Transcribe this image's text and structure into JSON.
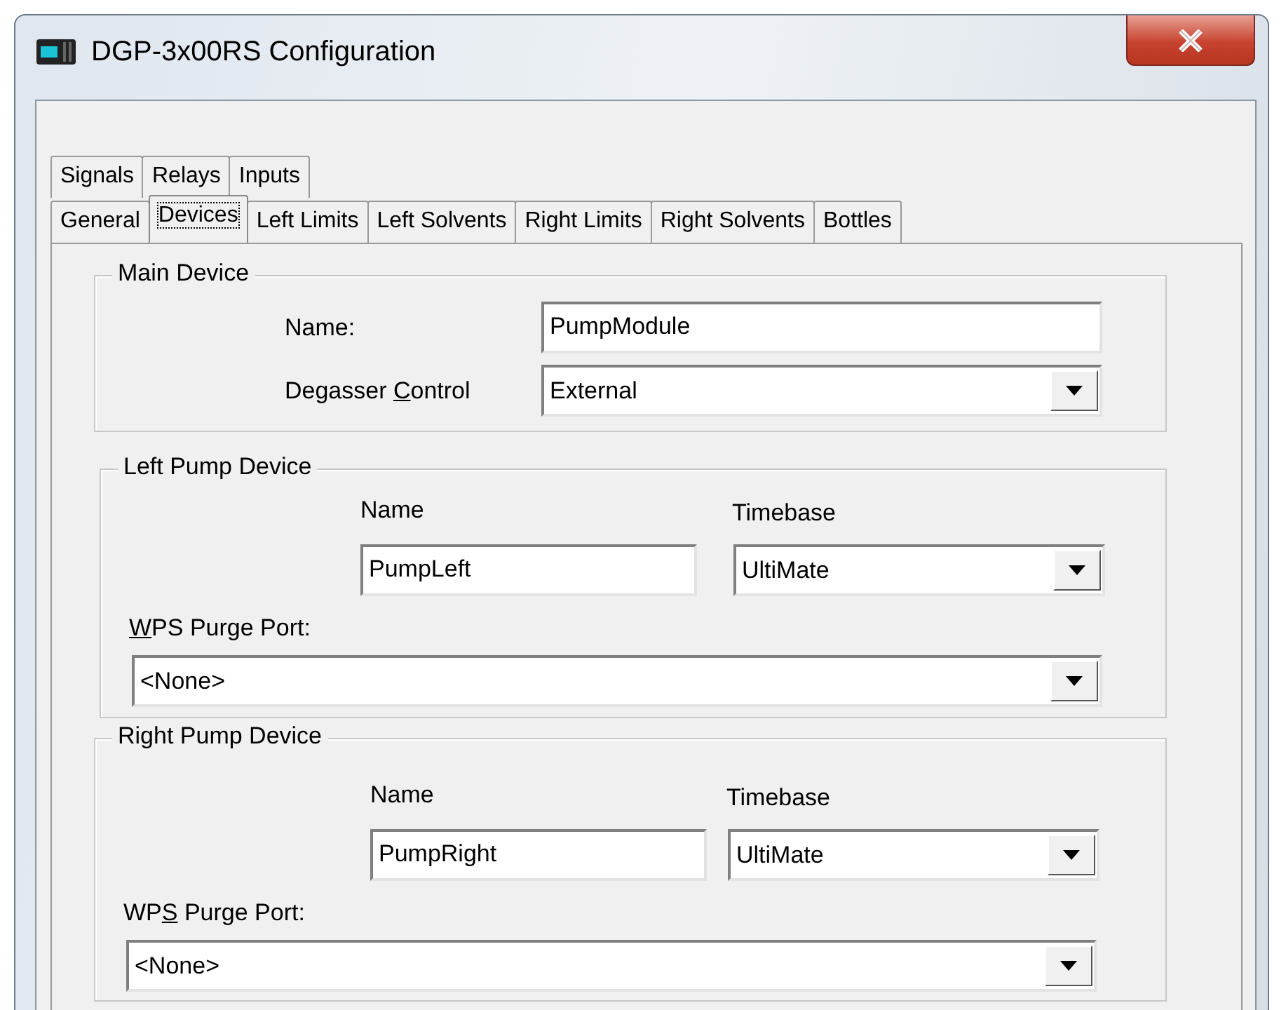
{
  "window": {
    "title": "DGP-3x00RS Configuration"
  },
  "tab_rows": [
    [
      {
        "label": "Signals",
        "selected": false
      },
      {
        "label": "Relays",
        "selected": false
      },
      {
        "label": "Inputs",
        "selected": false
      }
    ],
    [
      {
        "label": "General",
        "selected": false
      },
      {
        "label": "Devices",
        "selected": true
      },
      {
        "label": "Left Limits",
        "selected": false
      },
      {
        "label": "Left Solvents",
        "selected": false
      },
      {
        "label": "Right Limits",
        "selected": false
      },
      {
        "label": "Right Solvents",
        "selected": false
      },
      {
        "label": "Bottles",
        "selected": false
      }
    ]
  ],
  "main_device": {
    "title": "Main Device",
    "name_label": "Name:",
    "name_value": "PumpModule",
    "degasser_label": [
      {
        "text": "Degasser ",
        "underlined": false
      },
      {
        "text": "C",
        "underlined": true
      },
      {
        "text": "ontrol",
        "underlined": false
      }
    ],
    "degasser_value": "External"
  },
  "pump_devices": [
    {
      "title": "Left Pump Device",
      "name_label": "Name",
      "name_value": "PumpLeft",
      "timebase_label": "Timebase",
      "timebase_value": "UltiMate",
      "purge_label": [
        {
          "text": "W",
          "underlined": true
        },
        {
          "text": "PS Purge Port:",
          "underlined": false
        }
      ],
      "purge_value": "<None>"
    },
    {
      "title": "Right Pump Device",
      "name_label": "Name",
      "name_value": "PumpRight",
      "timebase_label": "Timebase",
      "timebase_value": "UltiMate",
      "purge_label": [
        {
          "text": "WP",
          "underlined": false
        },
        {
          "text": "S",
          "underlined": true
        },
        {
          "text": " Purge Port:",
          "underlined": false
        }
      ],
      "purge_value": "<None>"
    }
  ]
}
